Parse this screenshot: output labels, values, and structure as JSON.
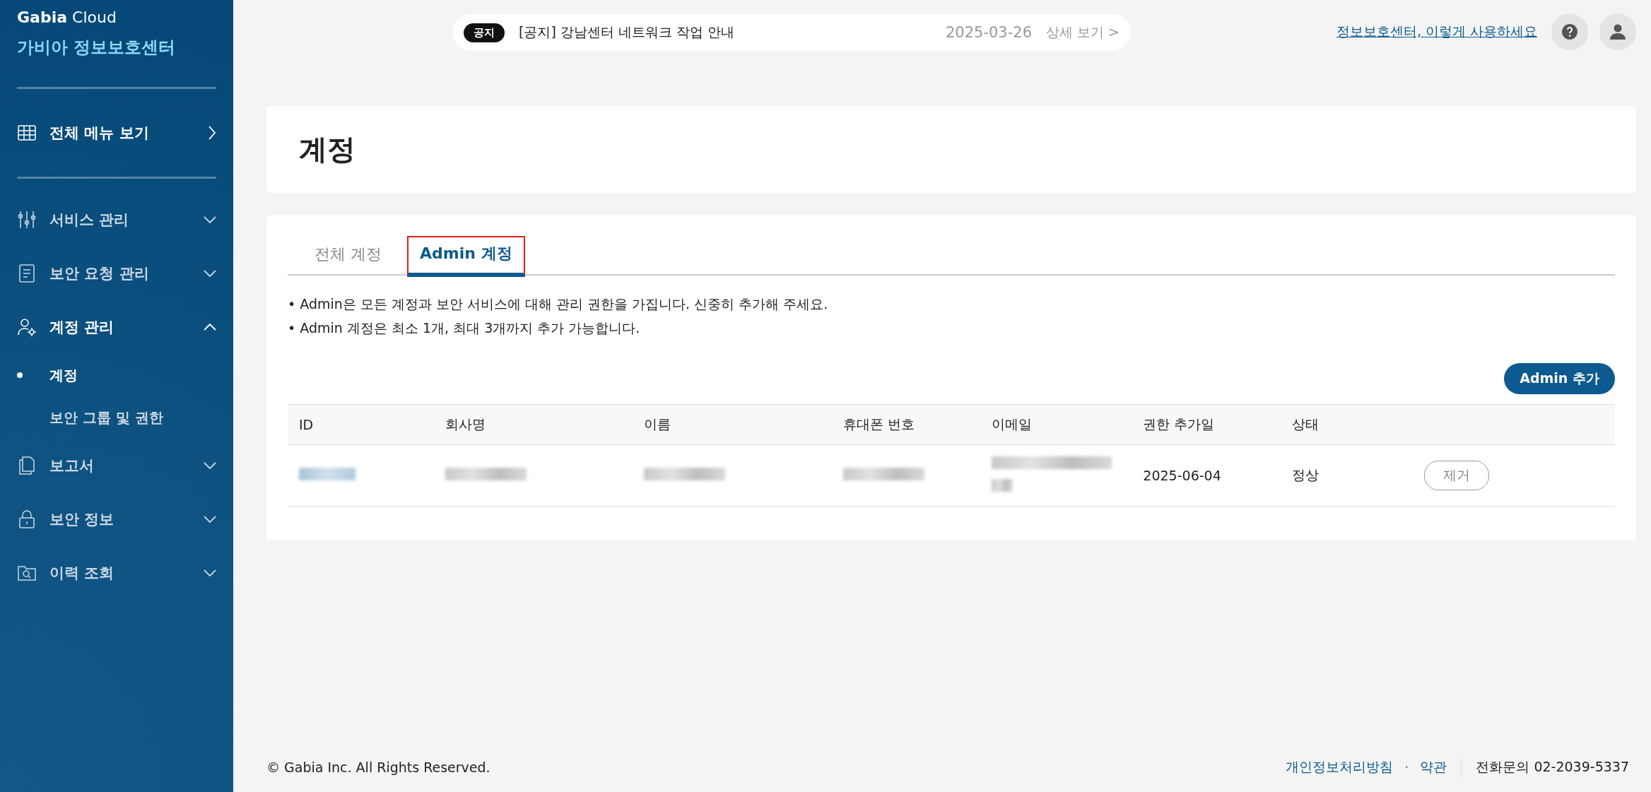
{
  "brand": {
    "logo_bold": "Gabia",
    "logo_light": "Cloud",
    "title": "가비아 정보보호센터"
  },
  "sidebar": {
    "items": [
      {
        "kind": "link",
        "label": "전체 메뉴 보기"
      },
      {
        "kind": "group",
        "label": "서비스 관리",
        "expanded": false
      },
      {
        "kind": "group",
        "label": "보안 요청 관리",
        "expanded": false
      },
      {
        "kind": "group",
        "label": "계정 관리",
        "expanded": true,
        "children": [
          {
            "label": "계정",
            "selected": true
          },
          {
            "label": "보안 그룹 및 권한",
            "selected": false
          }
        ]
      },
      {
        "kind": "group",
        "label": "보고서",
        "expanded": false
      },
      {
        "kind": "group",
        "label": "보안 정보",
        "expanded": false
      },
      {
        "kind": "group",
        "label": "이력 조회",
        "expanded": false
      }
    ]
  },
  "notice": {
    "badge": "공지",
    "text": "[공지] 강남센터 네트워크 작업 안내",
    "date": "2025-03-26",
    "more": "상세 보기 >"
  },
  "header": {
    "guide_link": "정보보호센터, 이렇게 사용하세요"
  },
  "page": {
    "title": "계정"
  },
  "tabs": [
    {
      "label": "전체 계정",
      "selected": false,
      "highlighted": false
    },
    {
      "label": "Admin 계정",
      "selected": true,
      "highlighted": true
    }
  ],
  "notes": [
    "• Admin은 모든 계정과 보안 서비스에 대해 관리 권한을 가집니다. 신중히 추가해 주세요.",
    "• Admin 계정은 최소 1개, 최대 3개까지 추가 가능합니다."
  ],
  "add_button": "Admin 추가",
  "table": {
    "columns": [
      "ID",
      "회사명",
      "이름",
      "휴대폰 번호",
      "이메일",
      "권한 추가일",
      "상태"
    ],
    "rows": [
      {
        "cells": [
          {
            "kind": "blurred-link"
          },
          {
            "kind": "blurred"
          },
          {
            "kind": "blurred"
          },
          {
            "kind": "blurred"
          },
          {
            "kind": "blurred-2line"
          },
          {
            "kind": "text",
            "text": "2025-06-04"
          },
          {
            "kind": "text",
            "text": "정상"
          }
        ],
        "action": "제거"
      }
    ]
  },
  "footer": {
    "copyright": "© Gabia Inc. All Rights Reserved.",
    "links": [
      "개인정보처리방침",
      "약관"
    ],
    "separator": "·",
    "phone": "전화문의 02-2039-5337"
  }
}
